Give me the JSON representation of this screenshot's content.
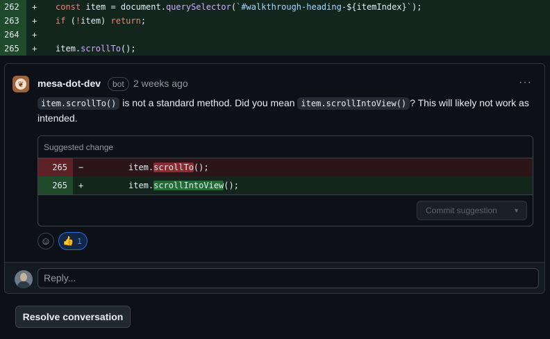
{
  "diff": {
    "rows": [
      {
        "line": "262",
        "sign": "+",
        "code": [
          {
            "t": "const",
            "c": "kw"
          },
          {
            "t": " item = document.",
            "c": ""
          },
          {
            "t": "querySelector",
            "c": "fn"
          },
          {
            "t": "(",
            "c": ""
          },
          {
            "t": "`#walkthrough-heading-",
            "c": "str"
          },
          {
            "t": "${itemIndex}",
            "c": ""
          },
          {
            "t": "`",
            "c": "str"
          },
          {
            "t": ");",
            "c": ""
          }
        ]
      },
      {
        "line": "263",
        "sign": "+",
        "code": [
          {
            "t": "if",
            "c": "kw"
          },
          {
            "t": " (",
            "c": ""
          },
          {
            "t": "!",
            "c": "kw"
          },
          {
            "t": "item) ",
            "c": ""
          },
          {
            "t": "return",
            "c": "kw"
          },
          {
            "t": ";",
            "c": ""
          }
        ]
      },
      {
        "line": "264",
        "sign": "+",
        "code": []
      },
      {
        "line": "265",
        "sign": "+",
        "code": [
          {
            "t": "item.",
            "c": ""
          },
          {
            "t": "scrollTo",
            "c": "fn"
          },
          {
            "t": "();",
            "c": ""
          }
        ]
      }
    ]
  },
  "comment": {
    "author": "mesa-dot-dev",
    "badge": "bot",
    "time": "2 weeks ago",
    "more": "···",
    "body_code_1": "item.scrollTo()",
    "body_text_1": " is not a standard method. Did you mean ",
    "body_code_2": "item.scrollIntoView()",
    "body_text_2": "? This will likely not work as intended.",
    "suggestion": {
      "header": "Suggested change",
      "del_line": "265",
      "del_sign": "−",
      "del_prefix": "item.",
      "del_highlight": "scrollTo",
      "del_suffix": "();",
      "add_line": "265",
      "add_sign": "+",
      "add_prefix": "item.",
      "add_highlight": "scrollIntoView",
      "add_suffix": "();",
      "commit_label": "Commit suggestion",
      "commit_caret": "▼"
    },
    "reactions": {
      "add_icon": "smiley-icon",
      "thumbs_emoji": "👍",
      "thumbs_count": "1"
    }
  },
  "reply": {
    "placeholder": "Reply..."
  },
  "resolve_label": "Resolve conversation",
  "colors": {
    "added_bg": "#12261e",
    "added_gutter": "#1f4a2c",
    "deleted_bg": "#2b1518",
    "deleted_gutter": "#5e2226",
    "accent": "#1f6feb"
  }
}
